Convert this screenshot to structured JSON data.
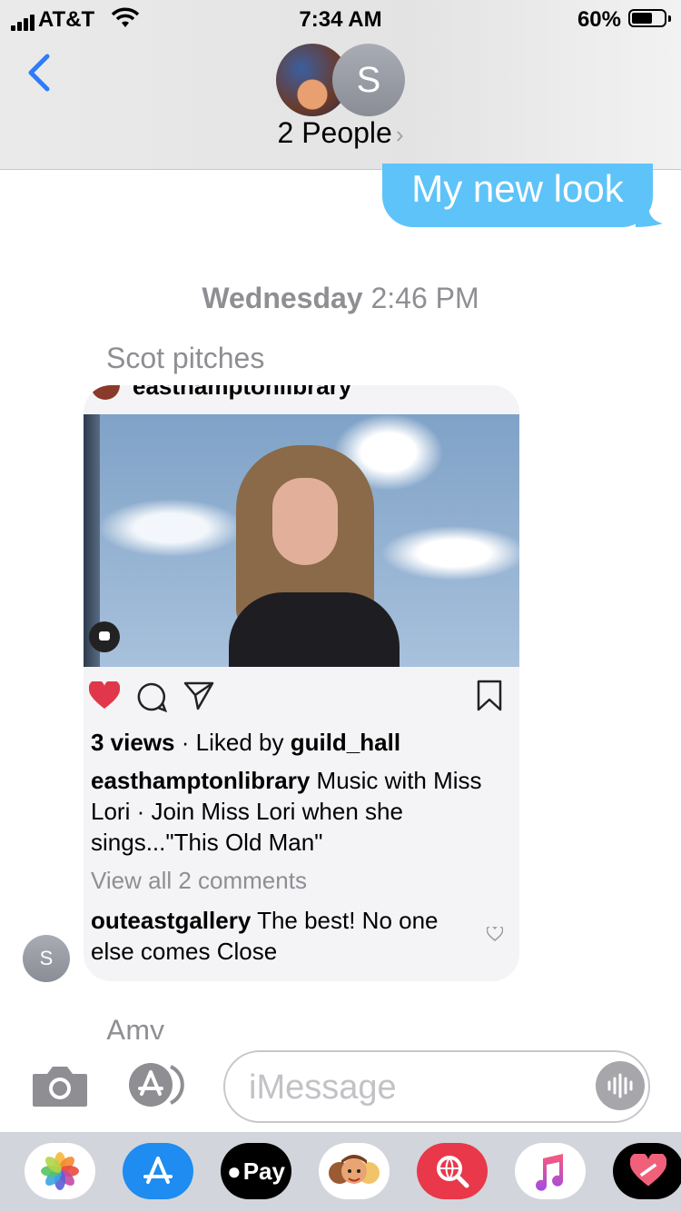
{
  "status_bar": {
    "carrier": "AT&T",
    "time": "7:34 AM",
    "battery": "60%",
    "battery_level": 0.6
  },
  "header": {
    "title": "2 People",
    "chevron": "›",
    "avatar_initial": "S"
  },
  "messages": {
    "sent": "My new look",
    "date_day": "Wednesday",
    "date_time": "2:46 PM",
    "sender": "Scot pitches",
    "next_sender": "Amy"
  },
  "instagram_card": {
    "account": "easthamptonlibrary",
    "views": "3 views",
    "liked_prefix": "· Liked by",
    "liked_by": "guild_hall",
    "caption_user": "easthamptonlibrary",
    "caption_text": "Music with Miss Lori · Join Miss Lori when she sings...\"This Old Man\"",
    "view_comments": "View all 2 comments",
    "comment_user": "outeastgallery",
    "comment_text": "The best! No one else comes Close",
    "sender_avatar_initial": "S"
  },
  "input": {
    "placeholder": "iMessage"
  },
  "app_drawer": {
    "apps": [
      "photos-icon",
      "app-store-icon",
      "apple-pay-icon",
      "memoji-icon",
      "web-search-icon",
      "music-icon",
      "heart-app-icon"
    ],
    "pay_label": "Pay"
  },
  "colors": {
    "accent": "#2f7cf6",
    "bubble": "#5ec3f9",
    "like": "#e0384a"
  }
}
